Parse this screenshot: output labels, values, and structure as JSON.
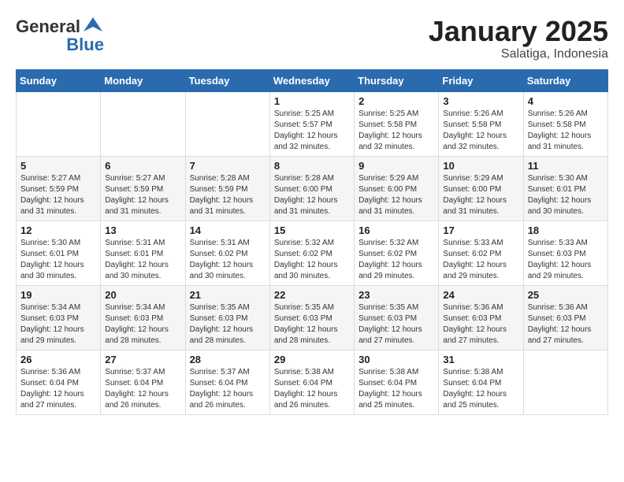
{
  "header": {
    "logo_general": "General",
    "logo_blue": "Blue",
    "month": "January 2025",
    "location": "Salatiga, Indonesia"
  },
  "days_of_week": [
    "Sunday",
    "Monday",
    "Tuesday",
    "Wednesday",
    "Thursday",
    "Friday",
    "Saturday"
  ],
  "weeks": [
    [
      {
        "day": "",
        "info": ""
      },
      {
        "day": "",
        "info": ""
      },
      {
        "day": "",
        "info": ""
      },
      {
        "day": "1",
        "info": "Sunrise: 5:25 AM\nSunset: 5:57 PM\nDaylight: 12 hours and 32 minutes."
      },
      {
        "day": "2",
        "info": "Sunrise: 5:25 AM\nSunset: 5:58 PM\nDaylight: 12 hours and 32 minutes."
      },
      {
        "day": "3",
        "info": "Sunrise: 5:26 AM\nSunset: 5:58 PM\nDaylight: 12 hours and 32 minutes."
      },
      {
        "day": "4",
        "info": "Sunrise: 5:26 AM\nSunset: 5:58 PM\nDaylight: 12 hours and 31 minutes."
      }
    ],
    [
      {
        "day": "5",
        "info": "Sunrise: 5:27 AM\nSunset: 5:59 PM\nDaylight: 12 hours and 31 minutes."
      },
      {
        "day": "6",
        "info": "Sunrise: 5:27 AM\nSunset: 5:59 PM\nDaylight: 12 hours and 31 minutes."
      },
      {
        "day": "7",
        "info": "Sunrise: 5:28 AM\nSunset: 5:59 PM\nDaylight: 12 hours and 31 minutes."
      },
      {
        "day": "8",
        "info": "Sunrise: 5:28 AM\nSunset: 6:00 PM\nDaylight: 12 hours and 31 minutes."
      },
      {
        "day": "9",
        "info": "Sunrise: 5:29 AM\nSunset: 6:00 PM\nDaylight: 12 hours and 31 minutes."
      },
      {
        "day": "10",
        "info": "Sunrise: 5:29 AM\nSunset: 6:00 PM\nDaylight: 12 hours and 31 minutes."
      },
      {
        "day": "11",
        "info": "Sunrise: 5:30 AM\nSunset: 6:01 PM\nDaylight: 12 hours and 30 minutes."
      }
    ],
    [
      {
        "day": "12",
        "info": "Sunrise: 5:30 AM\nSunset: 6:01 PM\nDaylight: 12 hours and 30 minutes."
      },
      {
        "day": "13",
        "info": "Sunrise: 5:31 AM\nSunset: 6:01 PM\nDaylight: 12 hours and 30 minutes."
      },
      {
        "day": "14",
        "info": "Sunrise: 5:31 AM\nSunset: 6:02 PM\nDaylight: 12 hours and 30 minutes."
      },
      {
        "day": "15",
        "info": "Sunrise: 5:32 AM\nSunset: 6:02 PM\nDaylight: 12 hours and 30 minutes."
      },
      {
        "day": "16",
        "info": "Sunrise: 5:32 AM\nSunset: 6:02 PM\nDaylight: 12 hours and 29 minutes."
      },
      {
        "day": "17",
        "info": "Sunrise: 5:33 AM\nSunset: 6:02 PM\nDaylight: 12 hours and 29 minutes."
      },
      {
        "day": "18",
        "info": "Sunrise: 5:33 AM\nSunset: 6:03 PM\nDaylight: 12 hours and 29 minutes."
      }
    ],
    [
      {
        "day": "19",
        "info": "Sunrise: 5:34 AM\nSunset: 6:03 PM\nDaylight: 12 hours and 29 minutes."
      },
      {
        "day": "20",
        "info": "Sunrise: 5:34 AM\nSunset: 6:03 PM\nDaylight: 12 hours and 28 minutes."
      },
      {
        "day": "21",
        "info": "Sunrise: 5:35 AM\nSunset: 6:03 PM\nDaylight: 12 hours and 28 minutes."
      },
      {
        "day": "22",
        "info": "Sunrise: 5:35 AM\nSunset: 6:03 PM\nDaylight: 12 hours and 28 minutes."
      },
      {
        "day": "23",
        "info": "Sunrise: 5:35 AM\nSunset: 6:03 PM\nDaylight: 12 hours and 27 minutes."
      },
      {
        "day": "24",
        "info": "Sunrise: 5:36 AM\nSunset: 6:03 PM\nDaylight: 12 hours and 27 minutes."
      },
      {
        "day": "25",
        "info": "Sunrise: 5:36 AM\nSunset: 6:03 PM\nDaylight: 12 hours and 27 minutes."
      }
    ],
    [
      {
        "day": "26",
        "info": "Sunrise: 5:36 AM\nSunset: 6:04 PM\nDaylight: 12 hours and 27 minutes."
      },
      {
        "day": "27",
        "info": "Sunrise: 5:37 AM\nSunset: 6:04 PM\nDaylight: 12 hours and 26 minutes."
      },
      {
        "day": "28",
        "info": "Sunrise: 5:37 AM\nSunset: 6:04 PM\nDaylight: 12 hours and 26 minutes."
      },
      {
        "day": "29",
        "info": "Sunrise: 5:38 AM\nSunset: 6:04 PM\nDaylight: 12 hours and 26 minutes."
      },
      {
        "day": "30",
        "info": "Sunrise: 5:38 AM\nSunset: 6:04 PM\nDaylight: 12 hours and 25 minutes."
      },
      {
        "day": "31",
        "info": "Sunrise: 5:38 AM\nSunset: 6:04 PM\nDaylight: 12 hours and 25 minutes."
      },
      {
        "day": "",
        "info": ""
      }
    ]
  ]
}
